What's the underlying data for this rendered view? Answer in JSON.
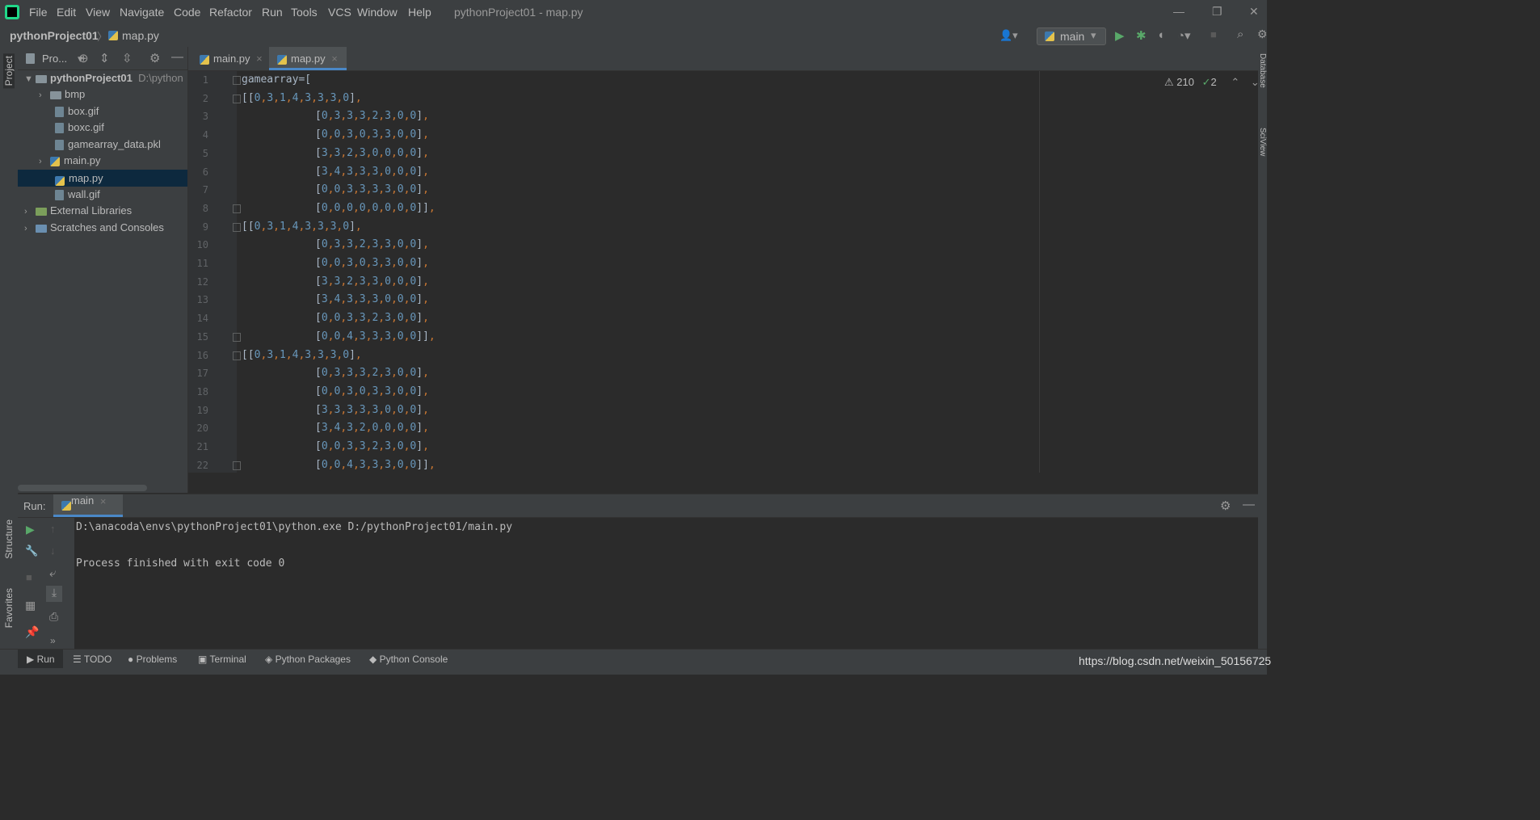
{
  "window": {
    "title": "pythonProject01 - map.py",
    "menu": [
      "File",
      "Edit",
      "View",
      "Navigate",
      "Code",
      "Refactor",
      "Run",
      "Tools",
      "VCS",
      "Window",
      "Help"
    ],
    "minimize": "—",
    "restore": "❐",
    "close": "✕"
  },
  "navbar": {
    "project": "pythonProject01",
    "separator": "〉",
    "file": "map.py",
    "run_config": "main"
  },
  "stripes": {
    "left_top": "Project",
    "left_mid": "Structure",
    "left_bottom": "Favorites",
    "right_top": "Database",
    "right_mid": "SciView"
  },
  "project_panel": {
    "title": "Pro...",
    "root": "pythonProject01",
    "root_path": "D:\\pythonProject01",
    "items": [
      {
        "label": "bmp",
        "kind": "folder"
      },
      {
        "label": "box.gif",
        "kind": "file"
      },
      {
        "label": "boxc.gif",
        "kind": "file"
      },
      {
        "label": "gamearray_data.pkl",
        "kind": "file"
      },
      {
        "label": "main.py",
        "kind": "py"
      },
      {
        "label": "map.py",
        "kind": "py"
      },
      {
        "label": "wall.gif",
        "kind": "file"
      }
    ],
    "external": "External Libraries",
    "scratches": "Scratches and Consoles"
  },
  "tabs": [
    {
      "label": "main.py"
    },
    {
      "label": "map.py"
    }
  ],
  "editor": {
    "warnings": "210",
    "checks": "2",
    "line_numbers": [
      "1",
      "2",
      "3",
      "4",
      "5",
      "6",
      "7",
      "8",
      "9",
      "10",
      "11",
      "12",
      "13",
      "14",
      "15",
      "16",
      "17",
      "18",
      "19",
      "20",
      "21",
      "22"
    ],
    "lines": [
      "gamearray=[",
      "[[0,3,1,4,3,3,3,0],",
      "[0,3,3,3,2,3,0,0],",
      "[0,0,3,0,3,3,0,0],",
      "[3,3,2,3,0,0,0,0],",
      "[3,4,3,3,3,0,0,0],",
      "[0,0,3,3,3,3,0,0],",
      "[0,0,0,0,0,0,0,0]],",
      "[[0,3,1,4,3,3,3,0],",
      "[0,3,3,2,3,3,0,0],",
      "[0,0,3,0,3,3,0,0],",
      "[3,3,2,3,3,0,0,0],",
      "[3,4,3,3,3,0,0,0],",
      "[0,0,3,3,2,3,0,0],",
      "[0,0,4,3,3,3,0,0]],",
      "[[0,3,1,4,3,3,3,0],",
      "[0,3,3,3,2,3,0,0],",
      "[0,0,3,0,3,3,0,0],",
      "[3,3,3,3,3,0,0,0],",
      "[3,4,3,2,0,0,0,0],",
      "[0,0,3,3,2,3,0,0],",
      "[0,0,4,3,3,3,0,0]],"
    ]
  },
  "run_panel": {
    "label": "Run:",
    "tab": "main",
    "console": [
      "D:\\anacoda\\envs\\pythonProject01\\python.exe D:/pythonProject01/main.py",
      "",
      "Process finished with exit code 0"
    ]
  },
  "bottom_tabs": [
    {
      "label": "Run"
    },
    {
      "label": "TODO"
    },
    {
      "label": "Problems"
    },
    {
      "label": "Terminal"
    },
    {
      "label": "Python Packages"
    },
    {
      "label": "Python Console"
    }
  ],
  "watermark": "https://blog.csdn.net/weixin_50156725"
}
